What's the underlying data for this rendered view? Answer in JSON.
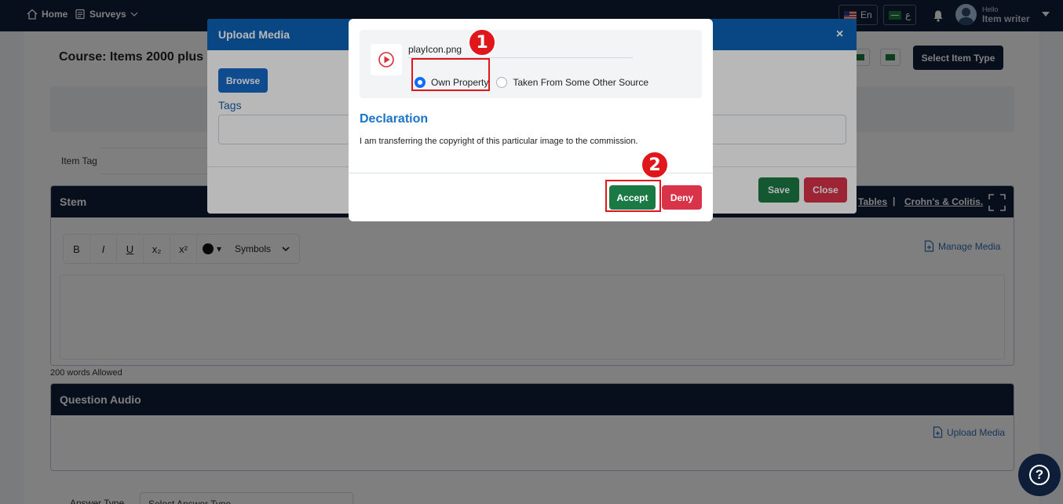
{
  "nav": {
    "home": "Home",
    "surveys": "Surveys",
    "lang_en": "En",
    "lang_ar": "ع",
    "user_greeting": "Hello",
    "user_name": "Item writer"
  },
  "page": {
    "course_title": "Course:  Items 2000 plus -",
    "select_item_type": "Select Item Type",
    "item_tag_label": "Item Tag",
    "stem": {
      "title": "Stem",
      "link_tables": "Tables",
      "separator": "|",
      "link_crohns": "Crohn's & Colitis."
    },
    "toolbar": {
      "bold": "B",
      "italic": "I",
      "underline": "U",
      "subscript": "x₂",
      "superscript": "x²",
      "color_caret": "▾",
      "symbols": "Symbols"
    },
    "manage_media": "Manage Media",
    "words_allowed": "200 words Allowed",
    "question_audio": {
      "title": "Question Audio",
      "upload_media": "Upload Media"
    },
    "answer_type_label": "Answer Type",
    "answer_type_placeholder": "Select Answer Type"
  },
  "upload_modal": {
    "title": "Upload Media",
    "close_icon": "×",
    "browse": "Browse",
    "tags_label": "Tags",
    "save": "Save",
    "close": "Close"
  },
  "declaration_modal": {
    "file_name": "playIcon.png",
    "options": {
      "own_property": "Own Property",
      "other_source": "Taken From Some Other Source"
    },
    "selected_option": "Own Property",
    "title": "Declaration",
    "text": "I am transferring the copyright of this particular image to the commission.",
    "accept": "Accept",
    "deny": "Deny"
  },
  "annotations": {
    "step1": "1",
    "step2": "2",
    "highlight_color": "#e0161b"
  },
  "help_label": "?",
  "colors": {
    "navbar": "#0e1e38",
    "modal_header": "#0c63b8",
    "accept": "#1b7a44",
    "deny": "#d9334a",
    "link_blue": "#2b6cb0"
  },
  "icons": [
    "home-icon",
    "surveys-icon",
    "bell-icon",
    "chevron-down-icon",
    "close-icon",
    "play-icon",
    "file-plus-icon",
    "expand-icon",
    "help-icon"
  ]
}
